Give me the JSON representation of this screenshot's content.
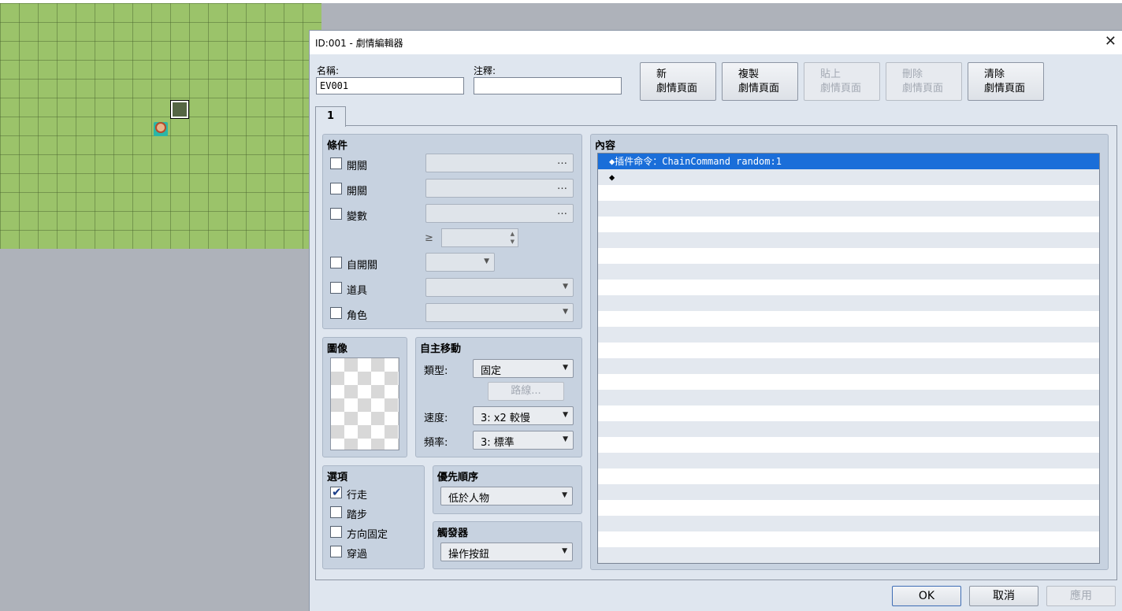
{
  "window": {
    "title": "ID:001 - 劇情編輯器",
    "close_glyph": "✕"
  },
  "name_label": "名稱:",
  "name_value": "EV001",
  "note_label": "注釋:",
  "note_value": "",
  "page_buttons": [
    {
      "line1": "新",
      "line2": "劇情頁面",
      "enabled": true
    },
    {
      "line1": "複製",
      "line2": "劇情頁面",
      "enabled": true
    },
    {
      "line1": "貼上",
      "line2": "劇情頁面",
      "enabled": false
    },
    {
      "line1": "刪除",
      "line2": "劇情頁面",
      "enabled": false
    },
    {
      "line1": "清除",
      "line2": "劇情頁面",
      "enabled": true
    }
  ],
  "tabs": [
    "1"
  ],
  "conditions": {
    "title": "條件",
    "switch1": {
      "label": "開關",
      "value": "",
      "dots": "…"
    },
    "switch2": {
      "label": "開關",
      "value": "",
      "dots": "…"
    },
    "variable": {
      "label": "變數",
      "value": "",
      "dots": "…"
    },
    "ge_symbol": "≥",
    "self_switch": {
      "label": "自開關",
      "value": ""
    },
    "item": {
      "label": "道具",
      "value": ""
    },
    "actor": {
      "label": "角色",
      "value": ""
    }
  },
  "image": {
    "title": "圖像"
  },
  "autonomous": {
    "title": "自主移動",
    "type_label": "類型:",
    "type_value": "固定",
    "route_button": "路線...",
    "speed_label": "速度:",
    "speed_value": "3: x2 較慢",
    "freq_label": "頻率:",
    "freq_value": "3: 標準"
  },
  "options": {
    "title": "選項",
    "items": [
      {
        "label": "行走",
        "checked": true
      },
      {
        "label": "踏步",
        "checked": false
      },
      {
        "label": "方向固定",
        "checked": false
      },
      {
        "label": "穿過",
        "checked": false
      }
    ]
  },
  "priority": {
    "title": "優先順序",
    "value": "低於人物"
  },
  "trigger": {
    "title": "觸發器",
    "value": "操作按鈕"
  },
  "contents": {
    "title": "內容",
    "lines": [
      "◆插件命令：ChainCommand random:1",
      "◆"
    ]
  },
  "footer": {
    "ok": "OK",
    "cancel": "取消",
    "apply": "應用"
  },
  "colors": {
    "selection": "#1a6ed9",
    "panel": "#c7d2e0",
    "map_grass": "#9bc36a"
  }
}
